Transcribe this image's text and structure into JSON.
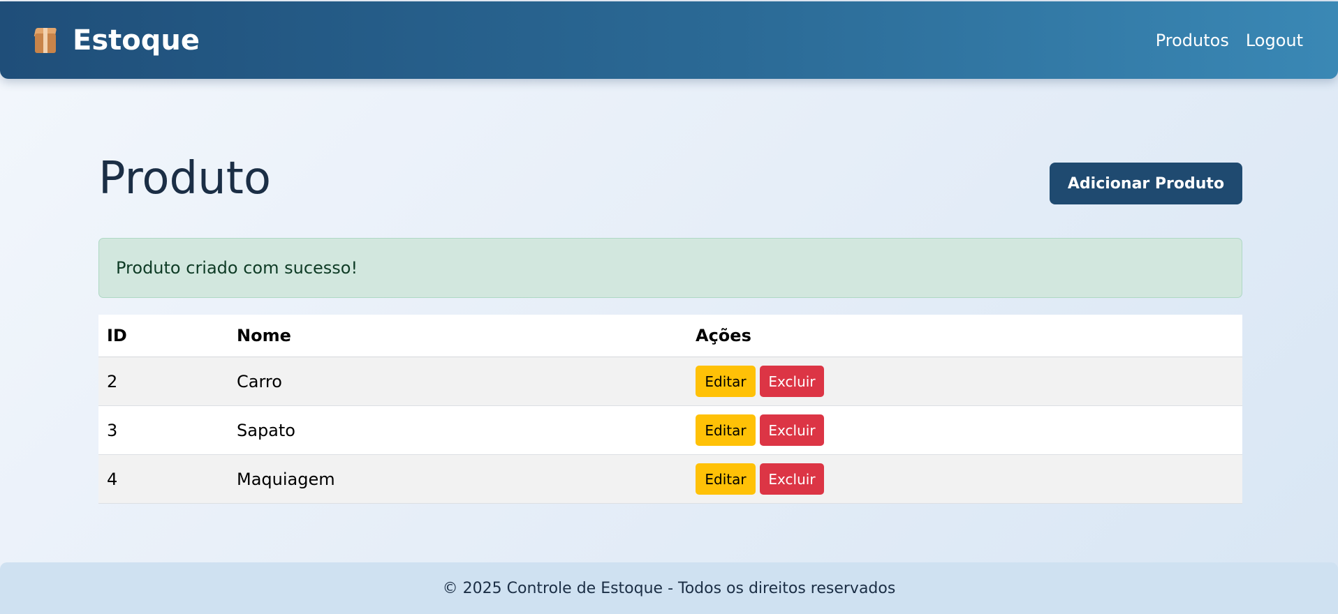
{
  "navbar": {
    "brand": "Estoque",
    "brand_icon": "package-icon",
    "links": [
      "Produtos",
      "Logout"
    ]
  },
  "page": {
    "title": "Produto",
    "add_button": "Adicionar Produto"
  },
  "alert": {
    "message": "Produto criado com sucesso!"
  },
  "table": {
    "headers": [
      "ID",
      "Nome",
      "Ações"
    ],
    "rows": [
      {
        "id": "2",
        "name": "Carro",
        "edit": "Editar",
        "delete": "Excluir"
      },
      {
        "id": "3",
        "name": "Sapato",
        "edit": "Editar",
        "delete": "Excluir"
      },
      {
        "id": "4",
        "name": "Maquiagem",
        "edit": "Editar",
        "delete": "Excluir"
      }
    ]
  },
  "footer": {
    "text": "© 2025 Controle de Estoque - Todos os direitos reservados"
  },
  "colors": {
    "navbar_start": "#1f4e79",
    "navbar_end": "#3a88b5",
    "primary_button": "#1f4a70",
    "edit_button": "#ffc107",
    "delete_button": "#dc3545",
    "alert_background": "#d2e7de",
    "footer_background": "#cfe1f1"
  }
}
